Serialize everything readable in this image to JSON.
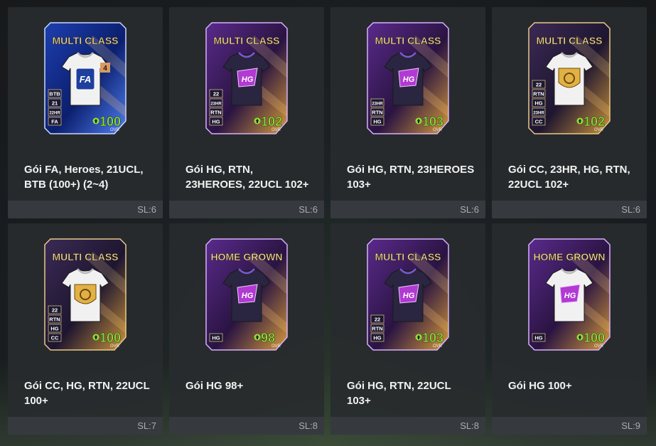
{
  "packs": [
    {
      "title": "Gói FA, Heroes, 21UCL, BTB (100+) (2~4)",
      "count": "SL:6",
      "card": {
        "header": "MULTI CLASS",
        "ovr": "100",
        "ovr_label": "OVR",
        "shirt": "white",
        "theme": "blue",
        "logo": "FA",
        "badges": [
          "BTB",
          "21",
          "22HR",
          "FA"
        ],
        "corner": "4"
      }
    },
    {
      "title": "Gói HG, RTN, 23HEROES, 22UCL 102+",
      "count": "SL:6",
      "card": {
        "header": "MULTI CLASS",
        "ovr": "102",
        "ovr_label": "OVR",
        "shirt": "dark",
        "theme": "purple",
        "logo": "HG",
        "badges": [
          "22",
          "23HR",
          "RTN",
          "HG"
        ]
      }
    },
    {
      "title": "Gói HG, RTN, 23HEROES 103+",
      "count": "SL:6",
      "card": {
        "header": "MULTI CLASS",
        "ovr": "103",
        "ovr_label": "OVR",
        "shirt": "dark",
        "theme": "purple",
        "logo": "HG",
        "badges": [
          "23HR",
          "RTN",
          "HG"
        ]
      }
    },
    {
      "title": "Gói CC, 23HR, HG, RTN, 22UCL 102+",
      "count": "SL:6",
      "card": {
        "header": "MULTI CLASS",
        "ovr": "102",
        "ovr_label": "OVR",
        "shirt": "white",
        "theme": "gold",
        "logo": "CC",
        "badges": [
          "22",
          "RTN",
          "HG",
          "23HR",
          "CC"
        ]
      }
    },
    {
      "title": "Gói CC, HG, RTN, 22UCL 100+",
      "count": "SL:7",
      "card": {
        "header": "MULTI CLASS",
        "ovr": "100",
        "ovr_label": "OVR",
        "shirt": "white",
        "theme": "gold",
        "logo": "CC",
        "badges": [
          "22",
          "RTN",
          "HG",
          "CC"
        ]
      }
    },
    {
      "title": "Gói HG 98+",
      "count": "SL:8",
      "card": {
        "header": "HOME GROWN",
        "ovr": "98",
        "ovr_label": "OVR",
        "shirt": "dark",
        "theme": "purple",
        "logo": "HG",
        "badges": [
          "HG"
        ]
      }
    },
    {
      "title": "Gói HG, RTN, 22UCL 103+",
      "count": "SL:8",
      "card": {
        "header": "MULTI CLASS",
        "ovr": "103",
        "ovr_label": "OVR",
        "shirt": "dark",
        "theme": "purple",
        "logo": "HG",
        "badges": [
          "22",
          "RTN",
          "HG"
        ]
      }
    },
    {
      "title": "Gói HG 100+",
      "count": "SL:9",
      "card": {
        "header": "HOME GROWN",
        "ovr": "100",
        "ovr_label": "OVR",
        "shirt": "white",
        "theme": "purple",
        "logo": "HG",
        "badges": [
          "HG"
        ]
      }
    }
  ],
  "colors": {
    "ovr": "#8fe03a",
    "header_text": "#f4e7a8",
    "tile_bg": "#282b2e",
    "count_text": "#a9adb1"
  }
}
